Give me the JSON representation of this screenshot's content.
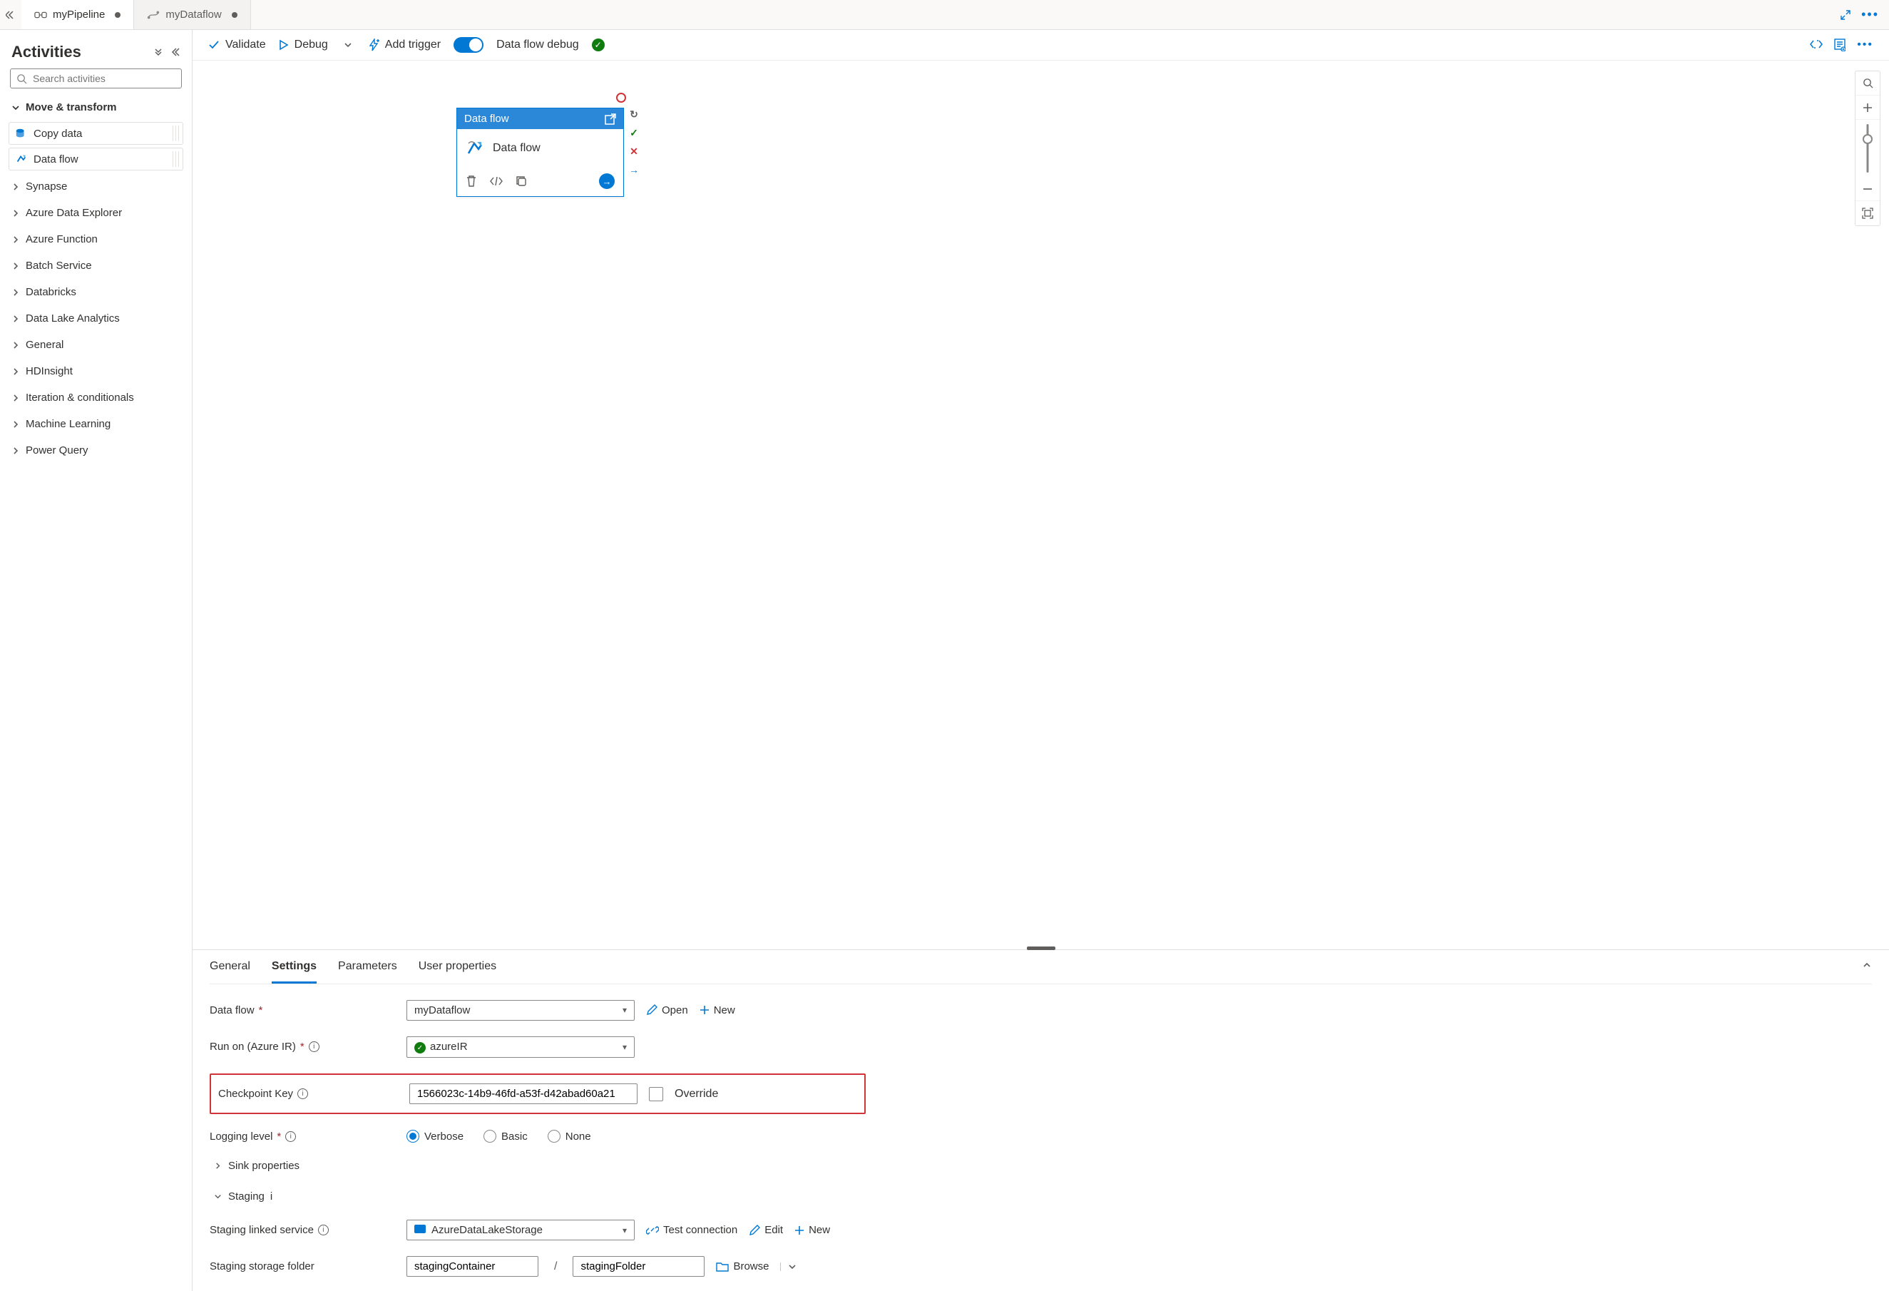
{
  "tabs": [
    {
      "label": "myPipeline",
      "dirty": true,
      "active": true
    },
    {
      "label": "myDataflow",
      "dirty": true,
      "active": false
    }
  ],
  "sidebar": {
    "title": "Activities",
    "search_placeholder": "Search activities",
    "open_group": "Move & transform",
    "activities": [
      {
        "label": "Copy data"
      },
      {
        "label": "Data flow"
      }
    ],
    "collapsed_groups": [
      "Synapse",
      "Azure Data Explorer",
      "Azure Function",
      "Batch Service",
      "Databricks",
      "Data Lake Analytics",
      "General",
      "HDInsight",
      "Iteration & conditionals",
      "Machine Learning",
      "Power Query"
    ]
  },
  "toolbar": {
    "validate": "Validate",
    "debug": "Debug",
    "add_trigger": "Add trigger",
    "dataflow_debug": "Data flow debug"
  },
  "canvas": {
    "node_type": "Data flow",
    "node_name": "Data flow"
  },
  "prop_tabs": [
    "General",
    "Settings",
    "Parameters",
    "User properties"
  ],
  "prop_active": "Settings",
  "settings": {
    "dataflow_label": "Data flow",
    "dataflow_value": "myDataflow",
    "open": "Open",
    "new": "New",
    "runon_label": "Run on (Azure IR)",
    "runon_value": "azureIR",
    "checkpoint_label": "Checkpoint Key",
    "checkpoint_value": "1566023c-14b9-46fd-a53f-d42abad60a21",
    "override": "Override",
    "logging_label": "Logging level",
    "logging_options": [
      "Verbose",
      "Basic",
      "None"
    ],
    "logging_selected": "Verbose",
    "sink_header": "Sink properties",
    "staging_header": "Staging",
    "staging_service_label": "Staging linked service",
    "staging_service_value": "AzureDataLakeStorage",
    "test_connection": "Test connection",
    "edit": "Edit",
    "staging_folder_label": "Staging storage folder",
    "staging_container": "stagingContainer",
    "staging_folder": "stagingFolder",
    "browse": "Browse"
  }
}
